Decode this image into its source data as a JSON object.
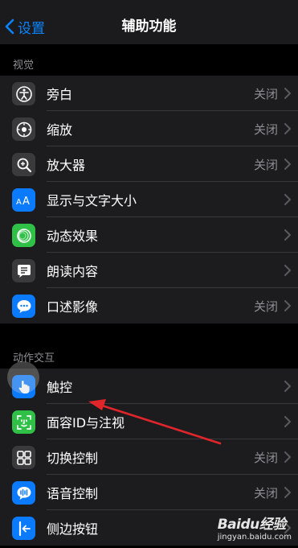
{
  "nav": {
    "back_label": "设置",
    "title": "辅助功能"
  },
  "sections": [
    {
      "header": "视觉",
      "items": [
        {
          "label": "旁白",
          "value": "关闭",
          "icon": "voiceover-icon",
          "color": "#3a3a3c"
        },
        {
          "label": "缩放",
          "value": "关闭",
          "icon": "zoom-icon",
          "color": "#3a3a3c"
        },
        {
          "label": "放大器",
          "value": "关闭",
          "icon": "magnifier-icon",
          "color": "#3a3a3c"
        },
        {
          "label": "显示与文字大小",
          "value": "",
          "icon": "text-size-icon",
          "color": "#0a7aff"
        },
        {
          "label": "动态效果",
          "value": "",
          "icon": "motion-icon",
          "color": "#30c048"
        },
        {
          "label": "朗读内容",
          "value": "",
          "icon": "spoken-content-icon",
          "color": "#3a3a3c"
        },
        {
          "label": "口述影像",
          "value": "关闭",
          "icon": "audio-description-icon",
          "color": "#0a7aff"
        }
      ]
    },
    {
      "header": "动作交互",
      "items": [
        {
          "label": "触控",
          "value": "",
          "icon": "touch-hand-icon",
          "color": "#0a7aff"
        },
        {
          "label": "面容ID与注视",
          "value": "",
          "icon": "face-id-icon",
          "color": "#30c048"
        },
        {
          "label": "切换控制",
          "value": "关闭",
          "icon": "switch-control-icon",
          "color": "#3a3a3c"
        },
        {
          "label": "语音控制",
          "value": "关闭",
          "icon": "voice-control-icon",
          "color": "#0a7aff"
        },
        {
          "label": "侧边按钮",
          "value": "",
          "icon": "side-button-icon",
          "color": "#0a7aff"
        }
      ]
    }
  ],
  "watermark": {
    "brand": "Baidu经验",
    "url": "jingyan.baidu.com"
  },
  "colors": {
    "accent": "#0a84ff",
    "annotation_arrow": "#e0252b"
  }
}
